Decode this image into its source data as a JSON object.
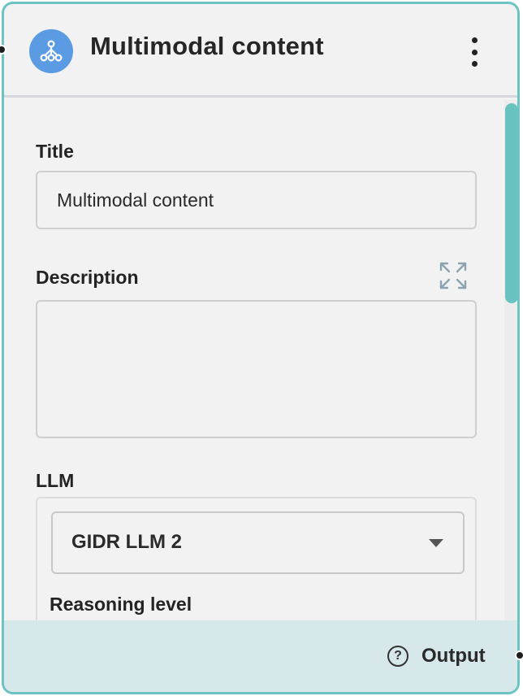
{
  "node": {
    "title": "Multimodal content",
    "accent_color": "#6cc3c1",
    "icon_color": "#5b9be3",
    "icon": "workflow-nodes-icon"
  },
  "fields": {
    "title_label": "Title",
    "title_value": "Multimodal content",
    "description_label": "Description",
    "description_value": "",
    "llm_label": "LLM",
    "llm_selected": "GIDR LLM 2",
    "reasoning_label": "Reasoning level"
  },
  "footer": {
    "output_label": "Output",
    "help_icon": "?"
  }
}
